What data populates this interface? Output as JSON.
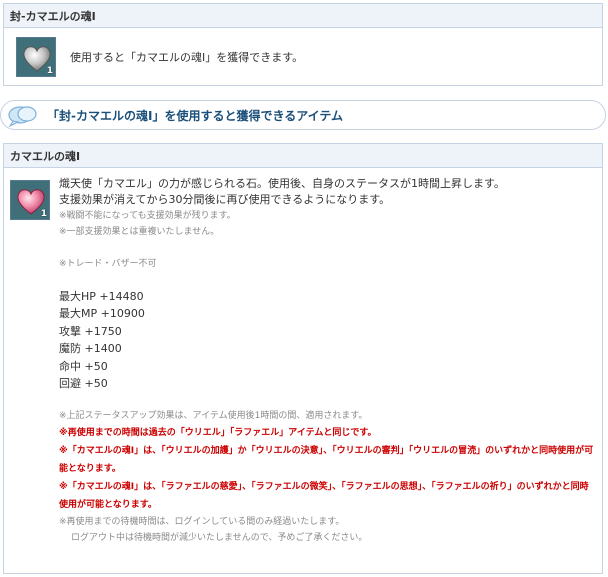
{
  "box1": {
    "title": "封-カマエルの魂Ⅰ",
    "icon": "silver-heart-icon",
    "quantity": "1",
    "description": "使用すると「カマエルの魂Ⅰ」を獲得できます。"
  },
  "bar": {
    "icon": "speech-bubble-icon",
    "title": "「封-カマエルの魂Ⅰ」を使用すると獲得できるアイテム"
  },
  "box2": {
    "title": "カマエルの魂Ⅰ",
    "icon": "pink-heart-icon",
    "quantity": "1",
    "desc1": "熾天使「カマエル」の力が感じられる石。使用後、自身のステータスが1時間上昇します。",
    "desc2": "支援効果が消えてから30分間後に再び使用できるようになります。",
    "note1": "※戦闘不能になっても支援効果が残ります。",
    "note2": "※一部支援効果とは重複いたしません。",
    "note3": "※トレード・バザー不可",
    "stats": [
      "最大HP +14480",
      "最大MP +10900",
      "攻撃 +1750",
      "魔防 +1400",
      "命中 +50",
      "回避 +50"
    ],
    "note4": "※上記ステータスアップ効果は、アイテム使用後1時間の間、適用されます。",
    "red1": "※再使用までの時間は過去の「ウリエル」「ラファエル」アイテムと同じです。",
    "red2": "※「カマエルの魂Ⅰ」は、「ウリエルの加護」か「ウリエルの決意」、「ウリエルの審判」「ウリエルの冒涜」のいずれかと同時使用が可能となります。",
    "red3": "※「カマエルの魂Ⅰ」は、「ラファエルの慈愛」、「ラファエルの微笑」、「ラファエルの思想」、「ラファエルの祈り」のいずれかと同時使用が可能となります。",
    "note5": "※再使用までの待機時間は、ログインしている間のみ経過いたします。",
    "note6": "ログアウト中は待機時間が減少いたしませんので、予めご了承ください。"
  }
}
